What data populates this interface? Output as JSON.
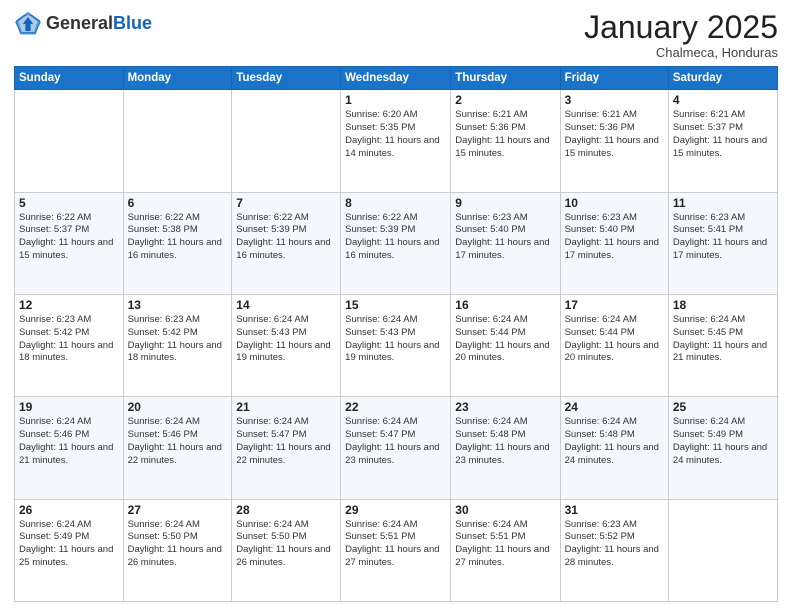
{
  "header": {
    "logo_general": "General",
    "logo_blue": "Blue",
    "month_title": "January 2025",
    "subtitle": "Chalmeca, Honduras"
  },
  "weekdays": [
    "Sunday",
    "Monday",
    "Tuesday",
    "Wednesday",
    "Thursday",
    "Friday",
    "Saturday"
  ],
  "weeks": [
    [
      {
        "day": "",
        "info": ""
      },
      {
        "day": "",
        "info": ""
      },
      {
        "day": "",
        "info": ""
      },
      {
        "day": "1",
        "info": "Sunrise: 6:20 AM\nSunset: 5:35 PM\nDaylight: 11 hours and 14 minutes."
      },
      {
        "day": "2",
        "info": "Sunrise: 6:21 AM\nSunset: 5:36 PM\nDaylight: 11 hours and 15 minutes."
      },
      {
        "day": "3",
        "info": "Sunrise: 6:21 AM\nSunset: 5:36 PM\nDaylight: 11 hours and 15 minutes."
      },
      {
        "day": "4",
        "info": "Sunrise: 6:21 AM\nSunset: 5:37 PM\nDaylight: 11 hours and 15 minutes."
      }
    ],
    [
      {
        "day": "5",
        "info": "Sunrise: 6:22 AM\nSunset: 5:37 PM\nDaylight: 11 hours and 15 minutes."
      },
      {
        "day": "6",
        "info": "Sunrise: 6:22 AM\nSunset: 5:38 PM\nDaylight: 11 hours and 16 minutes."
      },
      {
        "day": "7",
        "info": "Sunrise: 6:22 AM\nSunset: 5:39 PM\nDaylight: 11 hours and 16 minutes."
      },
      {
        "day": "8",
        "info": "Sunrise: 6:22 AM\nSunset: 5:39 PM\nDaylight: 11 hours and 16 minutes."
      },
      {
        "day": "9",
        "info": "Sunrise: 6:23 AM\nSunset: 5:40 PM\nDaylight: 11 hours and 17 minutes."
      },
      {
        "day": "10",
        "info": "Sunrise: 6:23 AM\nSunset: 5:40 PM\nDaylight: 11 hours and 17 minutes."
      },
      {
        "day": "11",
        "info": "Sunrise: 6:23 AM\nSunset: 5:41 PM\nDaylight: 11 hours and 17 minutes."
      }
    ],
    [
      {
        "day": "12",
        "info": "Sunrise: 6:23 AM\nSunset: 5:42 PM\nDaylight: 11 hours and 18 minutes."
      },
      {
        "day": "13",
        "info": "Sunrise: 6:23 AM\nSunset: 5:42 PM\nDaylight: 11 hours and 18 minutes."
      },
      {
        "day": "14",
        "info": "Sunrise: 6:24 AM\nSunset: 5:43 PM\nDaylight: 11 hours and 19 minutes."
      },
      {
        "day": "15",
        "info": "Sunrise: 6:24 AM\nSunset: 5:43 PM\nDaylight: 11 hours and 19 minutes."
      },
      {
        "day": "16",
        "info": "Sunrise: 6:24 AM\nSunset: 5:44 PM\nDaylight: 11 hours and 20 minutes."
      },
      {
        "day": "17",
        "info": "Sunrise: 6:24 AM\nSunset: 5:44 PM\nDaylight: 11 hours and 20 minutes."
      },
      {
        "day": "18",
        "info": "Sunrise: 6:24 AM\nSunset: 5:45 PM\nDaylight: 11 hours and 21 minutes."
      }
    ],
    [
      {
        "day": "19",
        "info": "Sunrise: 6:24 AM\nSunset: 5:46 PM\nDaylight: 11 hours and 21 minutes."
      },
      {
        "day": "20",
        "info": "Sunrise: 6:24 AM\nSunset: 5:46 PM\nDaylight: 11 hours and 22 minutes."
      },
      {
        "day": "21",
        "info": "Sunrise: 6:24 AM\nSunset: 5:47 PM\nDaylight: 11 hours and 22 minutes."
      },
      {
        "day": "22",
        "info": "Sunrise: 6:24 AM\nSunset: 5:47 PM\nDaylight: 11 hours and 23 minutes."
      },
      {
        "day": "23",
        "info": "Sunrise: 6:24 AM\nSunset: 5:48 PM\nDaylight: 11 hours and 23 minutes."
      },
      {
        "day": "24",
        "info": "Sunrise: 6:24 AM\nSunset: 5:48 PM\nDaylight: 11 hours and 24 minutes."
      },
      {
        "day": "25",
        "info": "Sunrise: 6:24 AM\nSunset: 5:49 PM\nDaylight: 11 hours and 24 minutes."
      }
    ],
    [
      {
        "day": "26",
        "info": "Sunrise: 6:24 AM\nSunset: 5:49 PM\nDaylight: 11 hours and 25 minutes."
      },
      {
        "day": "27",
        "info": "Sunrise: 6:24 AM\nSunset: 5:50 PM\nDaylight: 11 hours and 26 minutes."
      },
      {
        "day": "28",
        "info": "Sunrise: 6:24 AM\nSunset: 5:50 PM\nDaylight: 11 hours and 26 minutes."
      },
      {
        "day": "29",
        "info": "Sunrise: 6:24 AM\nSunset: 5:51 PM\nDaylight: 11 hours and 27 minutes."
      },
      {
        "day": "30",
        "info": "Sunrise: 6:24 AM\nSunset: 5:51 PM\nDaylight: 11 hours and 27 minutes."
      },
      {
        "day": "31",
        "info": "Sunrise: 6:23 AM\nSunset: 5:52 PM\nDaylight: 11 hours and 28 minutes."
      },
      {
        "day": "",
        "info": ""
      }
    ]
  ]
}
